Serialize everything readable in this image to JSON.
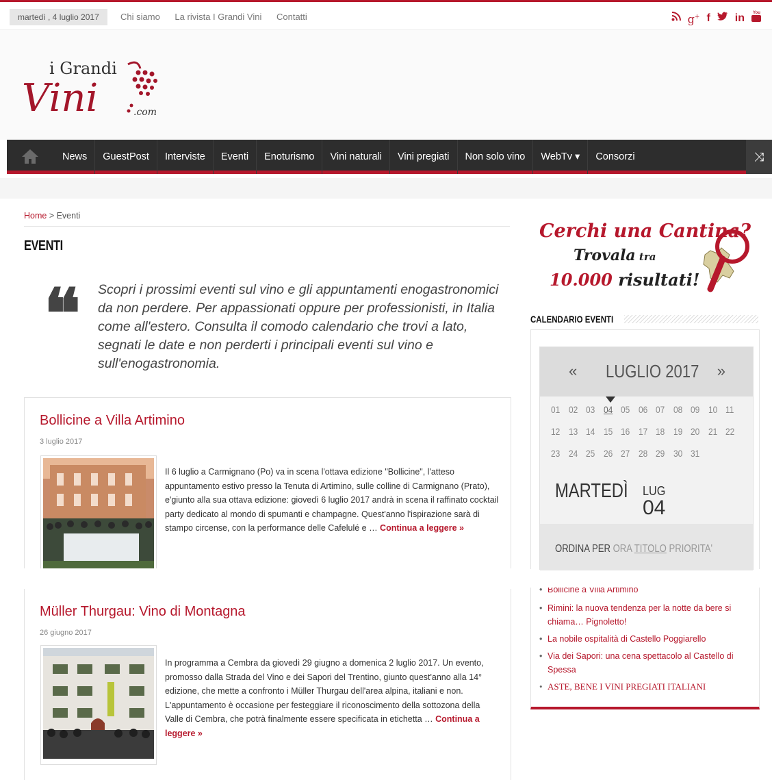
{
  "topbar": {
    "date": "martedì , 4 luglio 2017",
    "links": [
      "Chi siamo",
      "La rivista I Grandi Vini",
      "Contatti"
    ],
    "social_icons": [
      "rss-icon",
      "google-plus-icon",
      "facebook-icon",
      "twitter-icon",
      "linkedin-icon",
      "youtube-icon"
    ]
  },
  "logo": {
    "line1": "i Grandi",
    "line2": "Vini",
    "suffix": ".com"
  },
  "nav": {
    "items": [
      "News",
      "GuestPost",
      "Interviste",
      "Eventi",
      "Enoturismo",
      "Vini naturali",
      "Vini pregiati",
      "Non solo vino",
      "WebTv ▾",
      "Consorzi"
    ],
    "shuffle_icon": "⤨"
  },
  "breadcrumb": {
    "home": "Home",
    "sep": " > ",
    "current": "Eventi"
  },
  "page_title": "EVENTI",
  "quote_mark": "❝",
  "intro": "Scopri i prossimi eventi sul vino e gli appuntamenti enogastronomici da non perdere. Per appassionati oppure per professionisti, in Italia come all'estero. Consulta il comodo calendario che trovi a lato, segnati le date e non perderti i principali eventi sul vino e sull'enogastronomia.",
  "posts": [
    {
      "title": "Bollicine a Villa Artimino",
      "date": "3 luglio 2017",
      "excerpt": "Il 6 luglio a Carmignano (Po) va in scena l'ottava edizione  \"Bollicine\", l'atteso appuntamento  estivo presso la  Tenuta di Artimino, sulle colline di Carmignano (Prato), e'giunto alla sua ottava edizione: giovedì 6 luglio 2017 andrà in scena il raffinato cocktail party dedicato al mondo di spumanti e champagne. Quest'anno l'ispirazione sarà di stampo circense,  con la performance delle Cafelulé e … ",
      "more": "Continua a leggere »"
    },
    {
      "title": "Müller Thurgau: Vino di Montagna",
      "date": "26 giugno 2017",
      "excerpt": " In programma a Cembra da giovedì 29 giugno a domenica 2 luglio 2017. Un evento, promosso dalla Strada del Vino e dei Sapori del Trentino,  giunto quest'anno alla 14° edizione, che mette a confronto i Müller Thurgau dell'area alpina, italiani e non. L'appuntamento è occasione per festeggiare il riconoscimento della sottozona della Valle di Cembra, che potrà finalmente essere specificata in etichetta … ",
      "more": "Continua a leggere »"
    }
  ],
  "ad": {
    "line1": "Cerchi una Cantina?",
    "line2a": "Trovala",
    "line2b": " tra",
    "line3a": "10.000",
    "line3b": " risultati!"
  },
  "calendar": {
    "title": "CALENDARIO EVENTI",
    "prev": "«",
    "next": "»",
    "month": "LUGLIO 2017",
    "rows": [
      [
        "01",
        "02",
        "03",
        "04",
        "05",
        "06",
        "07",
        "08",
        "09",
        "10",
        "11"
      ],
      [
        "12",
        "13",
        "14",
        "15",
        "16",
        "17",
        "18",
        "19",
        "20",
        "21",
        "22"
      ],
      [
        "23",
        "24",
        "25",
        "26",
        "27",
        "28",
        "29",
        "30",
        "31"
      ]
    ],
    "today": "04",
    "weekday": "MARTEDÌ",
    "mon": "LUG",
    "day": "04",
    "order_label": "ORDINA PER",
    "order_options": [
      "ORA",
      "TITOLO",
      "PRIORITA'"
    ]
  },
  "event_list": [
    "Bollicine a Villa Artimino",
    "Rimini: la nuova tendenza per la notte da bere si chiama… Pignoletto!",
    "La nobile ospitalità di Castello Poggiarello",
    "Via dei Sapori: una cena spettacolo al Castello di Spessa",
    "ASTE, BENE I VINI PREGIATI ITALIANI"
  ],
  "colors": {
    "brand": "#b6182c",
    "nav_bg": "#2d2d2d"
  }
}
